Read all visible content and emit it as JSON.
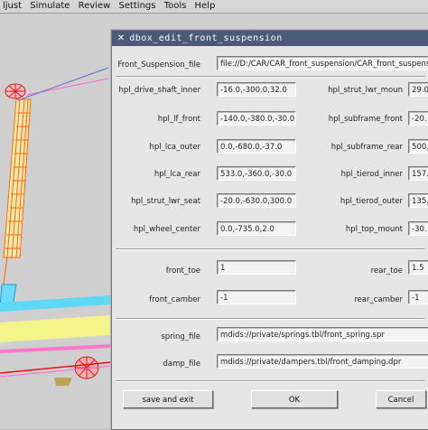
{
  "menu": [
    "ljust",
    "Simulate",
    "Review",
    "Settings",
    "Tools",
    "Help"
  ],
  "dialog": {
    "title": "dbox_edit_front_suspension",
    "file_label": "Front_Suspension_file",
    "file_value": "file://D:/CAR/CAR_front_suspension/CAR_front_suspension.cfg"
  },
  "left_fields": [
    {
      "label": "hpl_drive_shaft_inner",
      "value": "-16.0,-300.0,32.0"
    },
    {
      "label": "hpl_lf_front",
      "value": "-140.0,-380.0,-30.0"
    },
    {
      "label": "hpl_lca_outer",
      "value": "0.0,-680.0,-37.0"
    },
    {
      "label": "hpl_lca_rear",
      "value": "533.0,-360.0,-30.0"
    },
    {
      "label": "hpl_strut_lwr_seat",
      "value": "-20.0,-630.0,300.0"
    },
    {
      "label": "hpl_wheel_center",
      "value": "0.0,-735.0,2.0"
    }
  ],
  "right_fields": [
    {
      "label": "hpl_strut_lwr_moun",
      "value": "29.0"
    },
    {
      "label": "hpl_subframe_front",
      "value": "-20."
    },
    {
      "label": "hpl_subframe_rear",
      "value": "500."
    },
    {
      "label": "hpl_tierod_inner",
      "value": "157."
    },
    {
      "label": "hpl_tierod_outer",
      "value": "135."
    },
    {
      "label": "hpl_top_mount",
      "value": "-30."
    }
  ],
  "middle": {
    "front_toe_label": "front_toe",
    "front_toe": "1",
    "rear_toe_label": "rear_toe",
    "rear_toe": "1.5",
    "front_camber_label": "front_camber",
    "front_camber": "-1",
    "rear_camber_label": "rear_camber",
    "rear_camber": "-1"
  },
  "files": {
    "spring_label": "spring_file",
    "spring_value": "mdids://private/springs.tbl/front_spring.spr",
    "damper_label": "damp_file",
    "damper_value": "mdids://private/dampers.tbl/front_damping.dpr"
  },
  "buttons": {
    "save_exit": "save and exit",
    "ok": "OK",
    "cancel": "Cancel"
  }
}
